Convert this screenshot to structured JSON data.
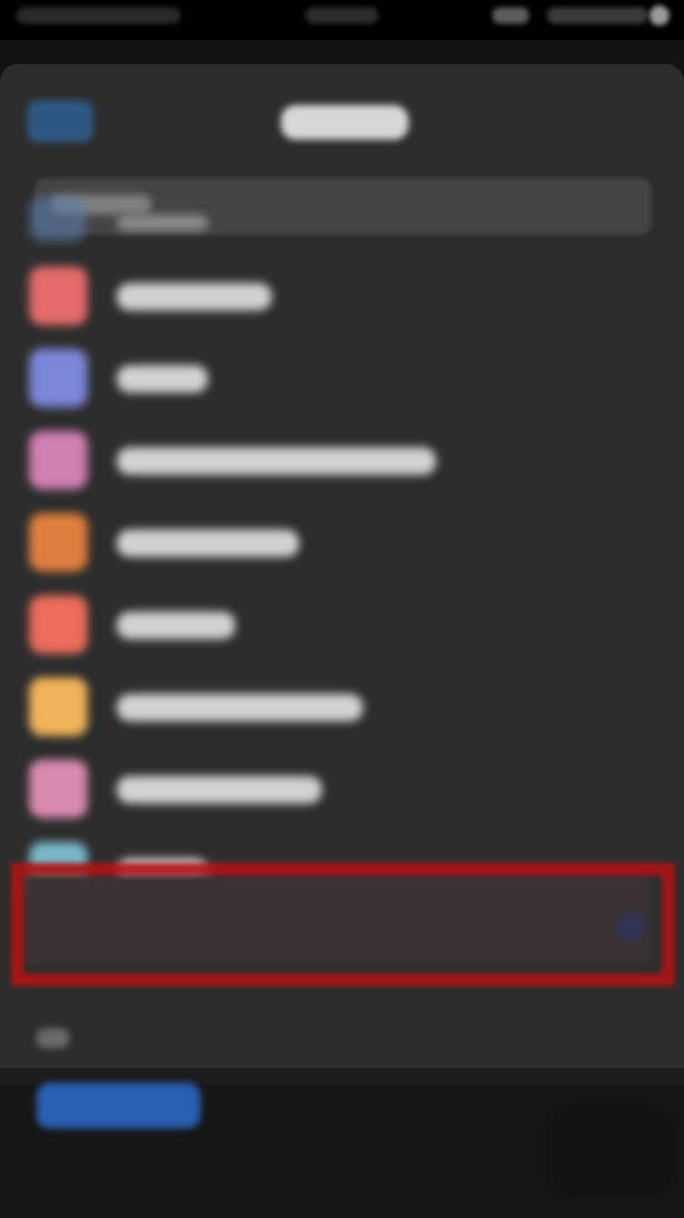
{
  "status_bar": {
    "time": "",
    "carrier": "",
    "battery": ""
  },
  "sheet": {
    "title": "",
    "back_label": ""
  },
  "search": {
    "placeholder": ""
  },
  "list": {
    "items": [
      {
        "label": "",
        "icon_color": "#5a7aa8",
        "icon": "app-icon"
      },
      {
        "label": "",
        "icon_color": "#e46b6b",
        "icon": "app-icon"
      },
      {
        "label": "",
        "icon_color": "#7b86d6",
        "icon": "app-icon"
      },
      {
        "label": "",
        "icon_color": "#d07fb0",
        "icon": "app-icon"
      },
      {
        "label": "",
        "icon_color": "#df7e3f",
        "icon": "app-icon"
      },
      {
        "label": "",
        "icon_color": "#ec6c5c",
        "icon": "app-icon"
      },
      {
        "label": "",
        "icon_color": "#f0b35a",
        "icon": "app-icon"
      },
      {
        "label": "",
        "icon_color": "#d98ab0",
        "icon": "app-icon"
      },
      {
        "label": "",
        "icon_color": "#78b7c8",
        "icon": "app-icon"
      }
    ],
    "highlighted_index": 8
  },
  "footer": {
    "label": ""
  },
  "bottom": {
    "button_label": ""
  },
  "colors": {
    "accent": "#2a5fb1",
    "highlight": "#b01414",
    "sheet_bg": "#2d2d2d",
    "page_bg": "#121212"
  }
}
